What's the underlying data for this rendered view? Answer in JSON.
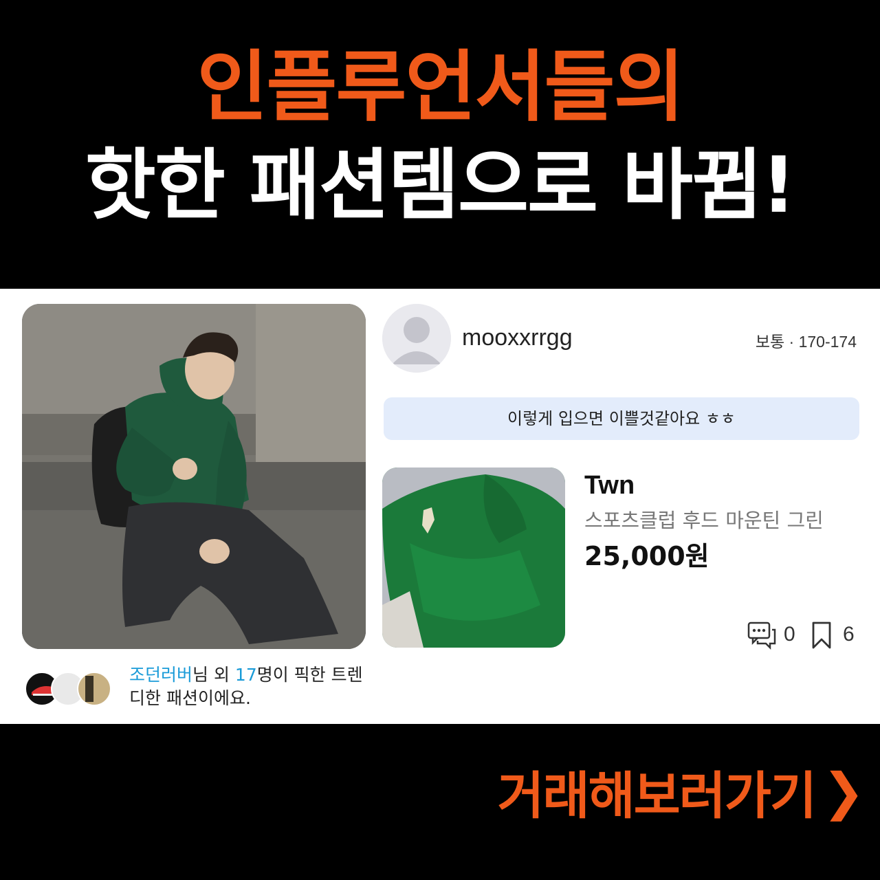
{
  "headline": {
    "line1": "인플루언서들의",
    "line2": "핫한 패션템으로 바뀜!"
  },
  "post": {
    "picked_by_user": "조던러버",
    "picked_mid1": "님 외 ",
    "picked_count": "17",
    "picked_mid2": "명이 픽한 트렌디한 패션이에요."
  },
  "seller": {
    "username": "mooxxrrgg",
    "size_info": "보통 · 170-174",
    "comment": "이렇게 입으면 이쁠것같아요 ㅎㅎ"
  },
  "product": {
    "brand": "Twn",
    "name": "스포츠클럽 후드 마운틴 그린",
    "price": "25,000원",
    "comment_count": "0",
    "bookmark_count": "6"
  },
  "cta": {
    "label": "거래해보러가기",
    "arrow": "❯"
  },
  "colors": {
    "accent_orange": "#f05a1a",
    "highlight_blue": "#1a9bd8",
    "comment_bg": "#e3ecfb"
  },
  "icons": [
    "chat-bubbles-icon",
    "bookmark-icon",
    "default-avatar-icon",
    "chevron-right-icon"
  ]
}
